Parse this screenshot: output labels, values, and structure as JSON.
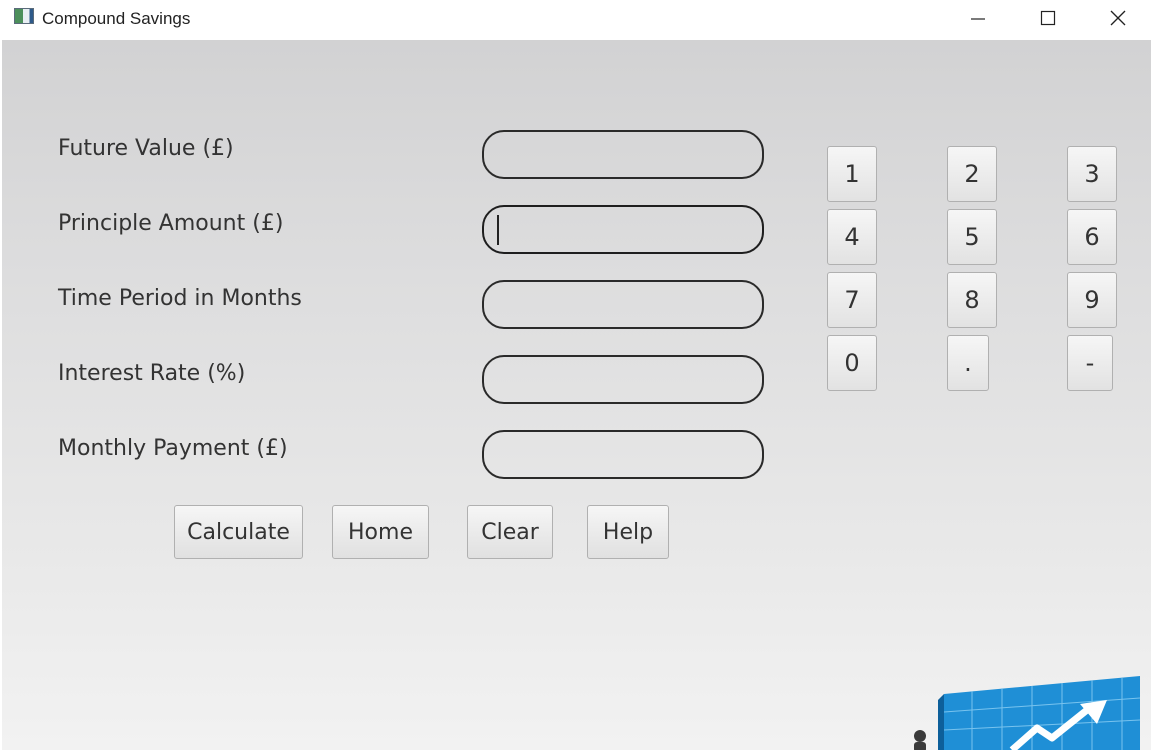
{
  "window": {
    "title": "Compound Savings",
    "controls": {
      "minimize": "─",
      "maximize": "☐",
      "close": "✕"
    }
  },
  "form": {
    "fields": [
      {
        "label": "Future Value (£)",
        "value": ""
      },
      {
        "label": "Principle Amount (£)",
        "value": ""
      },
      {
        "label": "Time Period in Months",
        "value": ""
      },
      {
        "label": "Interest Rate (%)",
        "value": ""
      },
      {
        "label": "Monthly Payment (£)",
        "value": ""
      }
    ]
  },
  "keypad": {
    "keys": [
      "1",
      "2",
      "3",
      "4",
      "5",
      "6",
      "7",
      "8",
      "9",
      "0",
      ".",
      "-"
    ]
  },
  "actions": {
    "calculate": "Calculate",
    "home": "Home",
    "clear": "Clear",
    "help": "Help"
  },
  "decoration": {
    "icon": "growth-chart-icon",
    "accent": "#1f8fd6"
  }
}
